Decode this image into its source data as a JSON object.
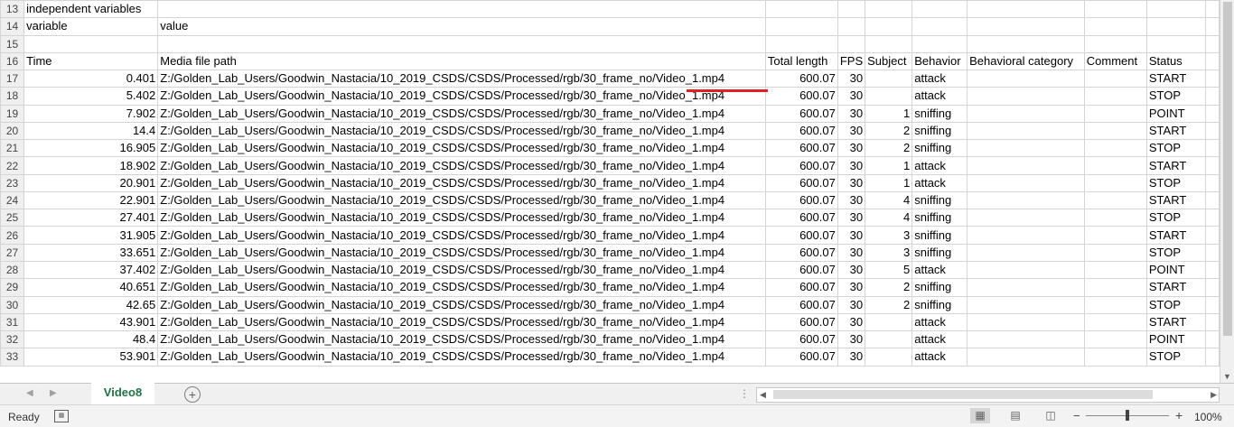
{
  "sheet": {
    "rows": [
      {
        "n": "13",
        "cells": [
          "independent variables",
          "",
          "",
          "",
          "",
          "",
          "",
          "",
          "",
          ""
        ]
      },
      {
        "n": "14",
        "cells": [
          "variable",
          "value",
          "",
          "",
          "",
          "",
          "",
          "",
          "",
          ""
        ]
      },
      {
        "n": "15",
        "cells": [
          "",
          "",
          "",
          "",
          "",
          "",
          "",
          "",
          "",
          ""
        ]
      },
      {
        "n": "16",
        "cells": [
          "Time",
          "Media file path",
          "Total length",
          "FPS",
          "Subject",
          "Behavior",
          "Behavioral category",
          "Comment",
          "Status",
          ""
        ]
      },
      {
        "n": "17",
        "cells": [
          "0.401",
          "Z:/Golden_Lab_Users/Goodwin_Nastacia/10_2019_CSDS/CSDS/Processed/rgb/30_frame_no/Video_1.mp4",
          "600.07",
          "30",
          "",
          "attack",
          "",
          "",
          "START",
          ""
        ]
      },
      {
        "n": "18",
        "cells": [
          "5.402",
          "Z:/Golden_Lab_Users/Goodwin_Nastacia/10_2019_CSDS/CSDS/Processed/rgb/30_frame_no/Video_1.mp4",
          "600.07",
          "30",
          "",
          "attack",
          "",
          "",
          "STOP",
          ""
        ]
      },
      {
        "n": "19",
        "cells": [
          "7.902",
          "Z:/Golden_Lab_Users/Goodwin_Nastacia/10_2019_CSDS/CSDS/Processed/rgb/30_frame_no/Video_1.mp4",
          "600.07",
          "30",
          "1",
          "sniffing",
          "",
          "",
          "POINT",
          ""
        ]
      },
      {
        "n": "20",
        "cells": [
          "14.4",
          "Z:/Golden_Lab_Users/Goodwin_Nastacia/10_2019_CSDS/CSDS/Processed/rgb/30_frame_no/Video_1.mp4",
          "600.07",
          "30",
          "2",
          "sniffing",
          "",
          "",
          "START",
          ""
        ]
      },
      {
        "n": "21",
        "cells": [
          "16.905",
          "Z:/Golden_Lab_Users/Goodwin_Nastacia/10_2019_CSDS/CSDS/Processed/rgb/30_frame_no/Video_1.mp4",
          "600.07",
          "30",
          "2",
          "sniffing",
          "",
          "",
          "STOP",
          ""
        ]
      },
      {
        "n": "22",
        "cells": [
          "18.902",
          "Z:/Golden_Lab_Users/Goodwin_Nastacia/10_2019_CSDS/CSDS/Processed/rgb/30_frame_no/Video_1.mp4",
          "600.07",
          "30",
          "1",
          "attack",
          "",
          "",
          "START",
          ""
        ]
      },
      {
        "n": "23",
        "cells": [
          "20.901",
          "Z:/Golden_Lab_Users/Goodwin_Nastacia/10_2019_CSDS/CSDS/Processed/rgb/30_frame_no/Video_1.mp4",
          "600.07",
          "30",
          "1",
          "attack",
          "",
          "",
          "STOP",
          ""
        ]
      },
      {
        "n": "24",
        "cells": [
          "22.901",
          "Z:/Golden_Lab_Users/Goodwin_Nastacia/10_2019_CSDS/CSDS/Processed/rgb/30_frame_no/Video_1.mp4",
          "600.07",
          "30",
          "4",
          "sniffing",
          "",
          "",
          "START",
          ""
        ]
      },
      {
        "n": "25",
        "cells": [
          "27.401",
          "Z:/Golden_Lab_Users/Goodwin_Nastacia/10_2019_CSDS/CSDS/Processed/rgb/30_frame_no/Video_1.mp4",
          "600.07",
          "30",
          "4",
          "sniffing",
          "",
          "",
          "STOP",
          ""
        ]
      },
      {
        "n": "26",
        "cells": [
          "31.905",
          "Z:/Golden_Lab_Users/Goodwin_Nastacia/10_2019_CSDS/CSDS/Processed/rgb/30_frame_no/Video_1.mp4",
          "600.07",
          "30",
          "3",
          "sniffing",
          "",
          "",
          "START",
          ""
        ]
      },
      {
        "n": "27",
        "cells": [
          "33.651",
          "Z:/Golden_Lab_Users/Goodwin_Nastacia/10_2019_CSDS/CSDS/Processed/rgb/30_frame_no/Video_1.mp4",
          "600.07",
          "30",
          "3",
          "sniffing",
          "",
          "",
          "STOP",
          ""
        ]
      },
      {
        "n": "28",
        "cells": [
          "37.402",
          "Z:/Golden_Lab_Users/Goodwin_Nastacia/10_2019_CSDS/CSDS/Processed/rgb/30_frame_no/Video_1.mp4",
          "600.07",
          "30",
          "5",
          "attack",
          "",
          "",
          "POINT",
          ""
        ]
      },
      {
        "n": "29",
        "cells": [
          "40.651",
          "Z:/Golden_Lab_Users/Goodwin_Nastacia/10_2019_CSDS/CSDS/Processed/rgb/30_frame_no/Video_1.mp4",
          "600.07",
          "30",
          "2",
          "sniffing",
          "",
          "",
          "START",
          ""
        ]
      },
      {
        "n": "30",
        "cells": [
          "42.65",
          "Z:/Golden_Lab_Users/Goodwin_Nastacia/10_2019_CSDS/CSDS/Processed/rgb/30_frame_no/Video_1.mp4",
          "600.07",
          "30",
          "2",
          "sniffing",
          "",
          "",
          "STOP",
          ""
        ]
      },
      {
        "n": "31",
        "cells": [
          "43.901",
          "Z:/Golden_Lab_Users/Goodwin_Nastacia/10_2019_CSDS/CSDS/Processed/rgb/30_frame_no/Video_1.mp4",
          "600.07",
          "30",
          "",
          "attack",
          "",
          "",
          "START",
          ""
        ]
      },
      {
        "n": "32",
        "cells": [
          "48.4",
          "Z:/Golden_Lab_Users/Goodwin_Nastacia/10_2019_CSDS/CSDS/Processed/rgb/30_frame_no/Video_1.mp4",
          "600.07",
          "30",
          "",
          "attack",
          "",
          "",
          "POINT",
          ""
        ]
      },
      {
        "n": "33",
        "cells": [
          "53.901",
          "Z:/Golden_Lab_Users/Goodwin_Nastacia/10_2019_CSDS/CSDS/Processed/rgb/30_frame_no/Video_1.mp4",
          "600.07",
          "30",
          "",
          "attack",
          "",
          "",
          "STOP",
          ""
        ]
      }
    ]
  },
  "tabs": {
    "active": "Video8"
  },
  "status": {
    "ready": "Ready",
    "zoom": "100%"
  },
  "icons": {
    "add_sheet": "plus-circle-icon",
    "macro": "macro-record-icon",
    "normal_view": "grid-view-icon",
    "page_layout": "page-layout-icon",
    "page_break": "page-break-icon"
  },
  "colors": {
    "accent": "#217346",
    "annotation": "#e02020"
  }
}
